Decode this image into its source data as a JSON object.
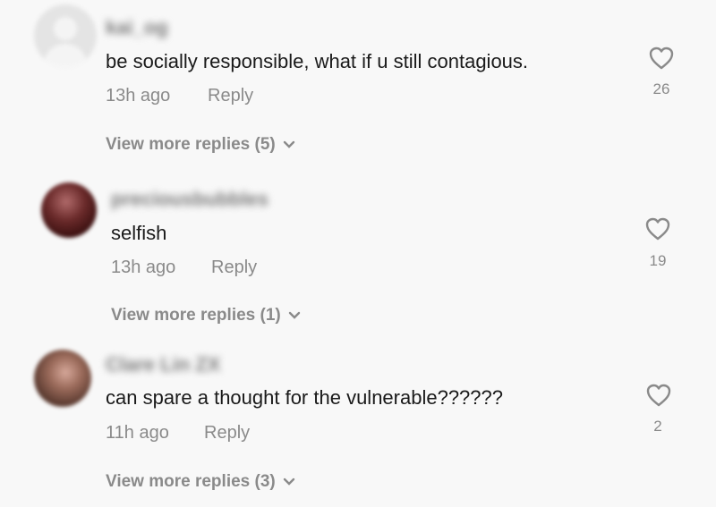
{
  "comments": [
    {
      "username": "kai_og",
      "text": "be socially responsible, what if u still contagious.",
      "time": "13h ago",
      "reply_label": "Reply",
      "likes": "26",
      "view_more": "View more replies (5)"
    },
    {
      "username": "preciousbubbles",
      "text": "selfish",
      "time": "13h ago",
      "reply_label": "Reply",
      "likes": "19",
      "view_more": "View more replies (1)"
    },
    {
      "username": "Clare Lin ZX",
      "text": "can spare a thought for the vulnerable??????",
      "time": "11h ago",
      "reply_label": "Reply",
      "likes": "2",
      "view_more": "View more replies (3)"
    }
  ],
  "icons": {
    "like": "heart-outline-icon",
    "expand": "chevron-down-icon",
    "avatar_default": "person-placeholder-icon"
  },
  "colors": {
    "background": "#f8f8f8",
    "text": "#1a1a1a",
    "secondary": "#8a8a8a"
  }
}
